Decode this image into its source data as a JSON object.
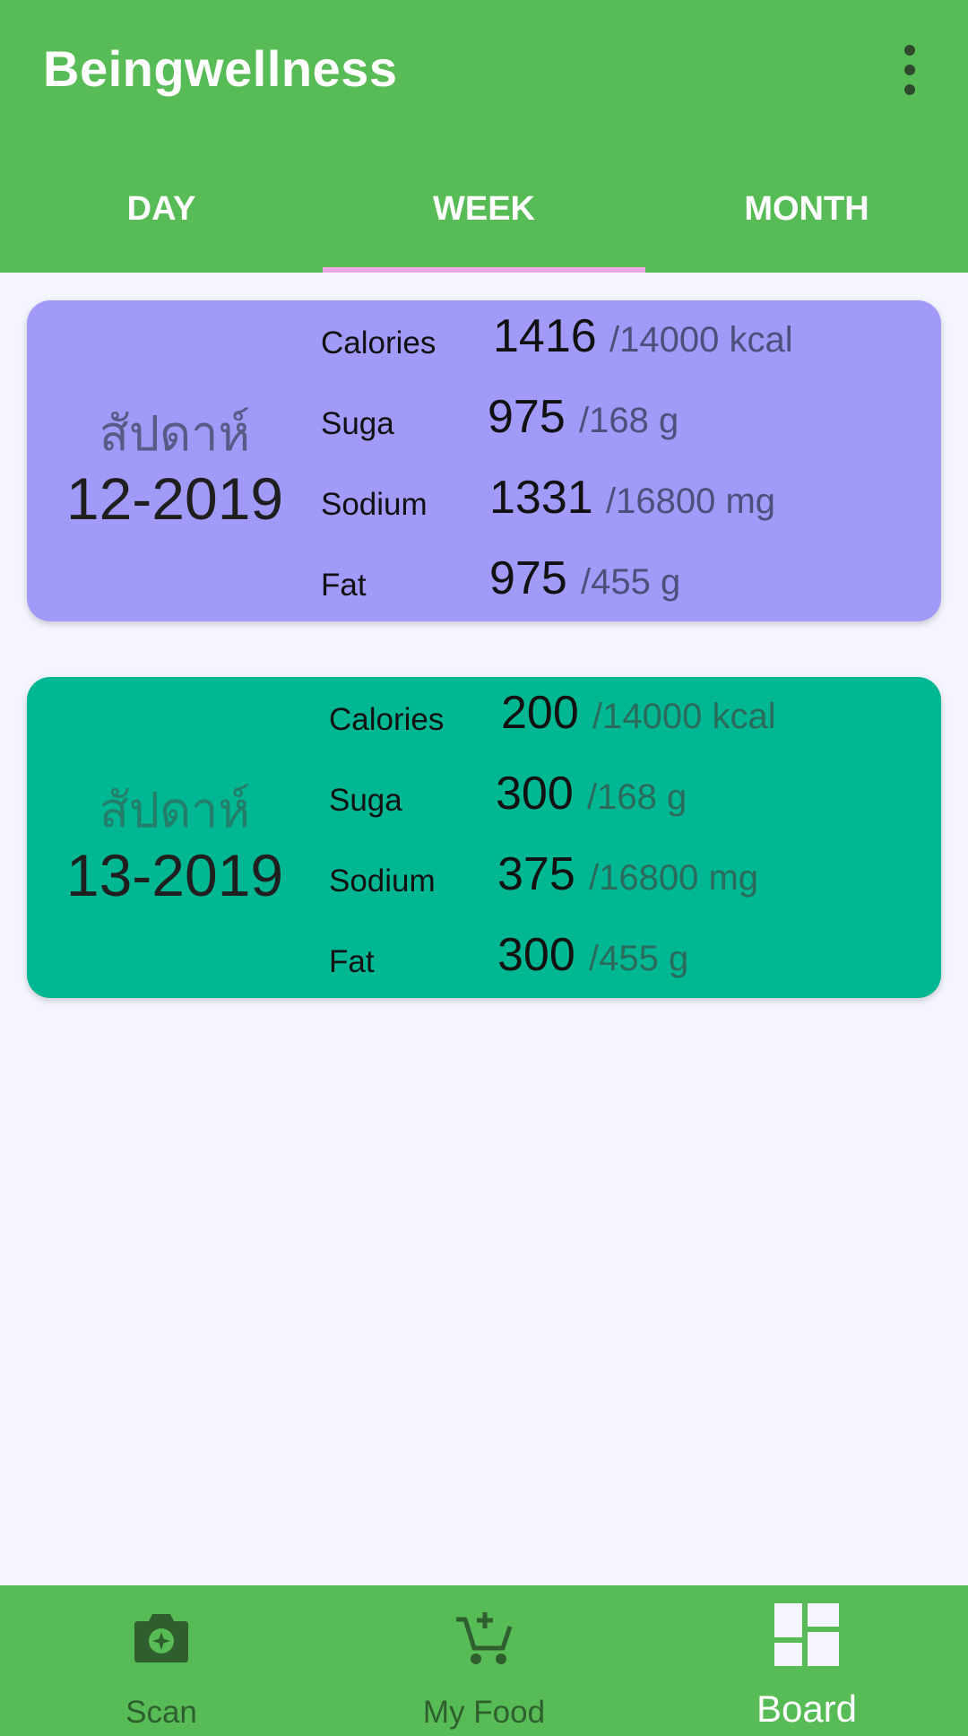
{
  "app": {
    "title": "Beingwellness"
  },
  "tabs": [
    "DAY",
    "WEEK",
    "MONTH"
  ],
  "active_tab": "WEEK",
  "cards": [
    {
      "label": "สัปดาห์",
      "week": "12-2019",
      "color": "#a19af9",
      "stats": [
        {
          "name": "Calories",
          "value": "1416",
          "limit": "/14000 kcal"
        },
        {
          "name": "Suga",
          "value": "975",
          "limit": "/168 g"
        },
        {
          "name": "Sodium",
          "value": "1331",
          "limit": "/16800 mg"
        },
        {
          "name": "Fat",
          "value": "975",
          "limit": "/455 g"
        }
      ]
    },
    {
      "label": "สัปดาห์",
      "week": "13-2019",
      "color": "#00b793",
      "stats": [
        {
          "name": "Calories",
          "value": "200",
          "limit": "/14000 kcal"
        },
        {
          "name": "Suga",
          "value": "300",
          "limit": "/168 g"
        },
        {
          "name": "Sodium",
          "value": "375",
          "limit": "/16800 mg"
        },
        {
          "name": "Fat",
          "value": "300",
          "limit": "/455 g"
        }
      ]
    }
  ],
  "bottom_nav": [
    {
      "label": "Scan",
      "icon": "camera-icon"
    },
    {
      "label": "My Food",
      "icon": "cart-add-icon"
    },
    {
      "label": "Board",
      "icon": "dashboard-icon"
    }
  ],
  "active_nav": "Board",
  "colors": {
    "appbar": "#58bc56",
    "tab_indicator": "#f0a7e4",
    "background": "#f5f6fd"
  }
}
